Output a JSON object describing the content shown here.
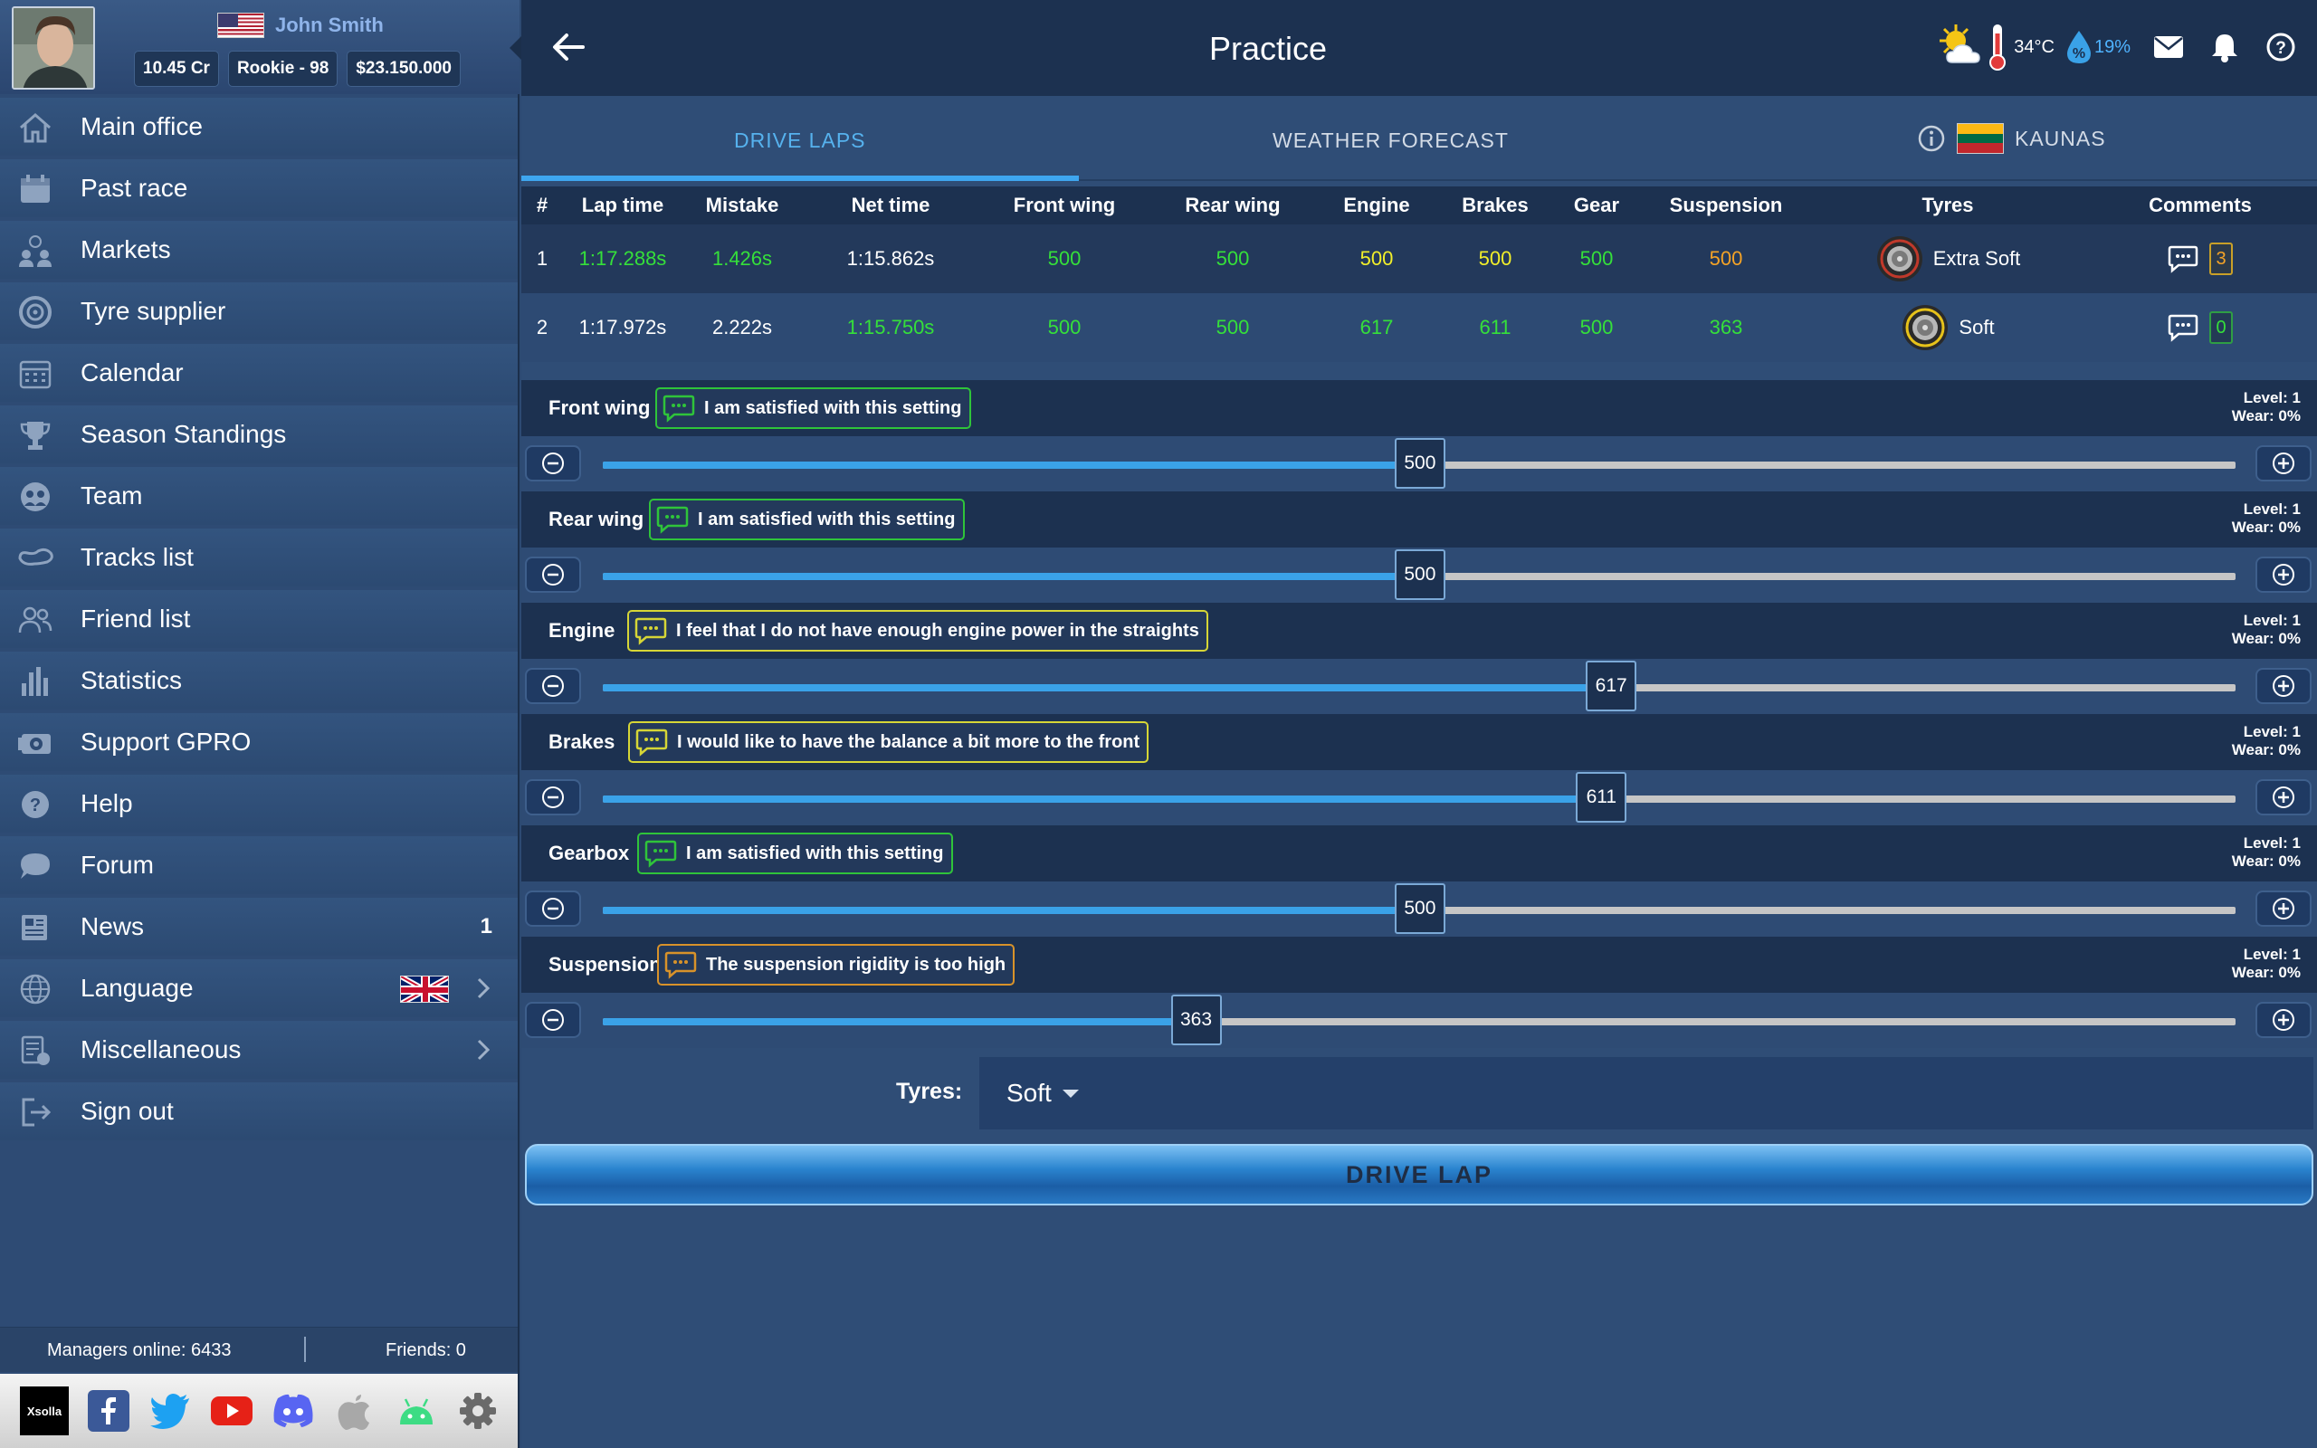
{
  "profile": {
    "name": "John Smith",
    "credits": "10.45 Cr",
    "level": "Rookie - 98",
    "money": "$23.150.000"
  },
  "sidebar": {
    "items": [
      {
        "label": "Main office",
        "icon": "home-icon"
      },
      {
        "label": "Past race",
        "icon": "calendar-icon"
      },
      {
        "label": "Markets",
        "icon": "people-icon"
      },
      {
        "label": "Tyre supplier",
        "icon": "tyre-icon"
      },
      {
        "label": "Calendar",
        "icon": "calendar-grid-icon"
      },
      {
        "label": "Season Standings",
        "icon": "trophy-icon"
      },
      {
        "label": "Team",
        "icon": "team-icon"
      },
      {
        "label": "Tracks list",
        "icon": "track-icon"
      },
      {
        "label": "Friend list",
        "icon": "friends-icon"
      },
      {
        "label": "Statistics",
        "icon": "bar-chart-icon"
      },
      {
        "label": "Support GPRO",
        "icon": "support-icon"
      },
      {
        "label": "Help",
        "icon": "help-icon"
      },
      {
        "label": "Forum",
        "icon": "chat-icon"
      },
      {
        "label": "News",
        "icon": "news-icon",
        "badge": "1"
      },
      {
        "label": "Language",
        "icon": "globe-icon"
      },
      {
        "label": "Miscellaneous",
        "icon": "misc-icon"
      },
      {
        "label": "Sign out",
        "icon": "sign-out-icon"
      }
    ],
    "online": "Managers online: 6433",
    "friends": "Friends: 0",
    "social": [
      "Xsolla"
    ]
  },
  "header": {
    "title": "Practice",
    "temperature": "34°C",
    "humidity": "19%"
  },
  "tabs": {
    "drive": "DRIVE LAPS",
    "weather": "WEATHER FORECAST",
    "track": "KAUNAS"
  },
  "table": {
    "headers": [
      "#",
      "Lap time",
      "Mistake",
      "Net time",
      "Front wing",
      "Rear wing",
      "Engine",
      "Brakes",
      "Gear",
      "Suspension",
      "Tyres",
      "Comments"
    ],
    "rows": [
      {
        "num": "1",
        "lap": "1:17.288s",
        "mistake": "1.426s",
        "net": "1:15.862s",
        "fw": "500",
        "rw": "500",
        "engine": "500",
        "brakes": "500",
        "gear": "500",
        "susp": "500",
        "tyres": "Extra Soft",
        "comments": "3"
      },
      {
        "num": "2",
        "lap": "1:17.972s",
        "mistake": "2.222s",
        "net": "1:15.750s",
        "fw": "500",
        "rw": "500",
        "engine": "617",
        "brakes": "611",
        "gear": "500",
        "susp": "363",
        "tyres": "Soft",
        "comments": "0"
      }
    ]
  },
  "settings": [
    {
      "name": "Front wing",
      "comment": "I am satisfied with this setting",
      "value": 500,
      "level": "Level: 1",
      "wear": "Wear: 0%"
    },
    {
      "name": "Rear wing",
      "comment": "I am satisfied with this setting",
      "value": 500,
      "level": "Level: 1",
      "wear": "Wear: 0%"
    },
    {
      "name": "Engine",
      "comment": "I feel that I do not have enough engine power in the straights",
      "value": 617,
      "level": "Level: 1",
      "wear": "Wear: 0%"
    },
    {
      "name": "Brakes",
      "comment": "I would like to have the balance a bit more to the front",
      "value": 611,
      "level": "Level: 1",
      "wear": "Wear: 0%"
    },
    {
      "name": "Gearbox",
      "comment": "I am satisfied with this setting",
      "value": 500,
      "level": "Level: 1",
      "wear": "Wear: 0%"
    },
    {
      "name": "Suspension",
      "comment": "The suspension rigidity is too high",
      "value": 363,
      "level": "Level: 1",
      "wear": "Wear: 0%"
    }
  ],
  "slider_max": 999,
  "tyres": {
    "label": "Tyres:",
    "value": "Soft"
  },
  "drive_button": "DRIVE LAP",
  "colors": {
    "green": "#35e03a",
    "yellow": "#f2ef2a",
    "orange": "#f5a326",
    "accent": "#3ea6ef"
  }
}
